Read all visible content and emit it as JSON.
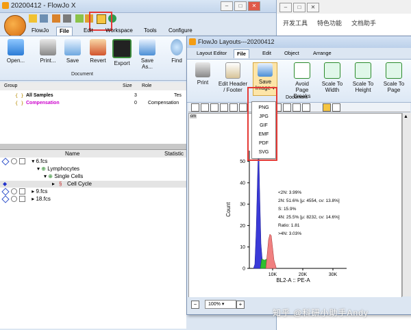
{
  "bg_app": {
    "menu": [
      "开发工具",
      "特色功能",
      "文档助手"
    ]
  },
  "main_window": {
    "title": "20200412 - FlowJo X",
    "tabs": [
      "FlowJo",
      "File",
      "Edit",
      "Workspace",
      "Tools",
      "Configure"
    ],
    "active_tab": "File",
    "ribbon_buttons": [
      "Open...",
      "Print...",
      "Save",
      "Revert",
      "Export",
      "Save As...",
      "Find"
    ],
    "ribbon_group": "Document",
    "table_headers": {
      "group": "Group",
      "size": "Size",
      "role": "Role"
    },
    "groups": [
      {
        "name": "All Samples",
        "size": "3",
        "role": "Tes"
      },
      {
        "name": "Compensation",
        "size": "0",
        "role": "Compensation"
      }
    ],
    "pop_headers": {
      "name": "Name",
      "stat": "Statistic"
    },
    "tree": [
      {
        "label": "6.fcs"
      },
      {
        "label": "Lymphocytes"
      },
      {
        "label": "Single Cells"
      },
      {
        "label": "Cell Cycle"
      },
      {
        "label": "9.fcs"
      },
      {
        "label": "18.fcs"
      }
    ]
  },
  "layout_window": {
    "title": "FlowJo Layouts---20200412",
    "tabs": [
      "Layout Editor",
      "File",
      "Edit",
      "Object",
      "Arrange"
    ],
    "active_tab": "File",
    "ribbon_buttons": {
      "print": "Print",
      "header": "Edit Header / Footer",
      "save": "Save",
      "save_sub": "Image",
      "avoid": "Avoid Page Breaks",
      "scale_width": "Scale To Width",
      "scale_height": "Scale To Height",
      "scale_page": "Scale To Page"
    },
    "ribbon_group": "Document",
    "canvas_tab": "cm",
    "save_formats": [
      "PNG",
      "JPG",
      "GIF",
      "EMF",
      "PDF",
      "SVG"
    ],
    "zoom": "100%"
  },
  "plot": {
    "ylabel": "Count",
    "xlabel": "BL2-A :: PE-A",
    "yticks": [
      "0",
      "10",
      "20",
      "30",
      "40",
      "50"
    ],
    "xticks": [
      "10K",
      "20K",
      "30K"
    ],
    "stats": [
      "<2N: 3.99%",
      "2N: 51.6%  [μ: 4554, cv: 13.8%]",
      "S: 15.9%",
      "4N: 25.5%  [μ: 8232, cv: 14.6%]",
      "Ratio: 1.81",
      ">4N: 3.03%"
    ]
  },
  "watermark": "知乎 @科研小助手Andy",
  "colors": {
    "highlight": "#e53935",
    "compensation": "#cc00cc",
    "g1_fill": "#3a3ad8",
    "s_fill": "#2fbf2f",
    "g2_fill": "#f08080"
  }
}
